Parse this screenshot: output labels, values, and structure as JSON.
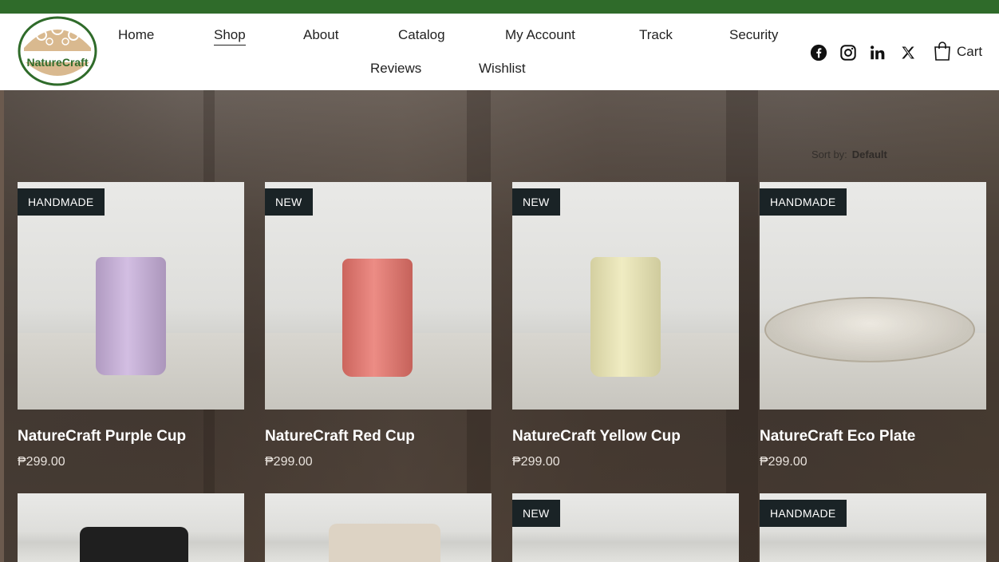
{
  "brand": {
    "name": "NatureCraft",
    "accent": "#2f6b2a"
  },
  "nav": {
    "home": "Home",
    "shop": "Shop",
    "about": "About",
    "catalog": "Catalog",
    "account": "My Account",
    "track": "Track",
    "security": "Security",
    "reviews": "Reviews",
    "wishlist": "Wishlist"
  },
  "social": [
    "facebook-icon",
    "instagram-icon",
    "linkedin-icon",
    "x-icon"
  ],
  "cart": {
    "label": "Cart"
  },
  "sort": {
    "label": "Sort by:",
    "value": "Default"
  },
  "products": [
    {
      "badge": "HANDMADE",
      "title": "NatureCraft Purple Cup",
      "price": "₱299.00",
      "color": "#c9b0dc"
    },
    {
      "badge": "NEW",
      "title": "NatureCraft Red Cup",
      "price": "₱299.00",
      "color": "#e8736a"
    },
    {
      "badge": "NEW",
      "title": "NatureCraft Yellow Cup",
      "price": "₱299.00",
      "color": "#ece7b3"
    },
    {
      "badge": "HANDMADE",
      "title": "NatureCraft Eco Plate",
      "price": "₱299.00",
      "color": "#e6e1d6"
    },
    {
      "badge": "",
      "color": "#1f1f1f"
    },
    {
      "badge": "",
      "color": "#ddd3c4"
    },
    {
      "badge": "NEW",
      "color": "#e8e8e6"
    },
    {
      "badge": "HANDMADE",
      "color": "#e8e8e6"
    }
  ]
}
